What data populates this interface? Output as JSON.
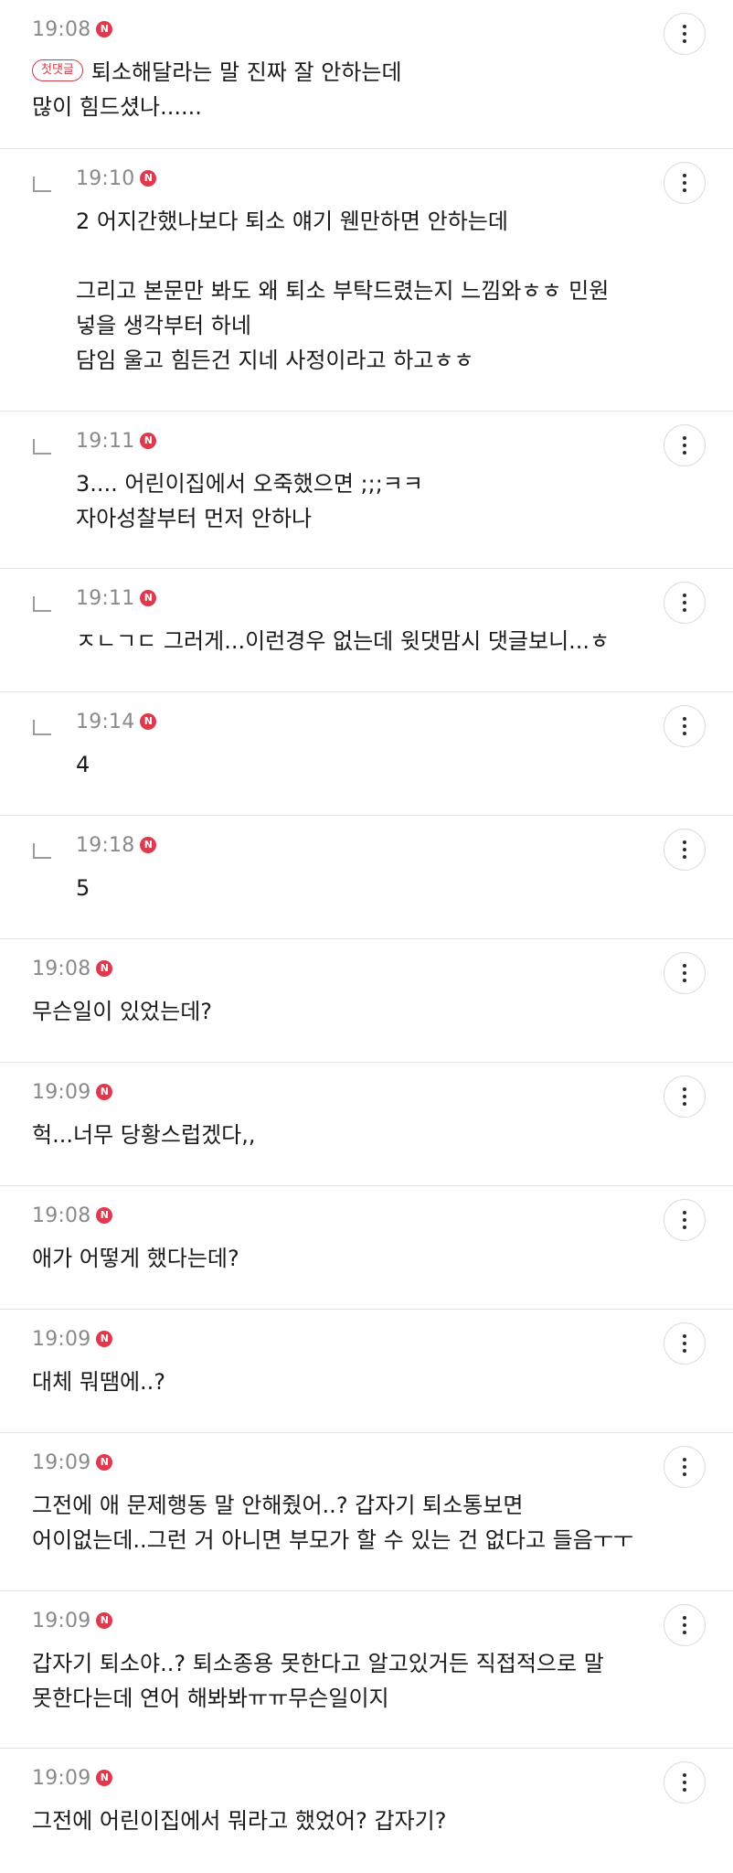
{
  "first_comment_label": "첫댓글",
  "comments": [
    {
      "time": "19:08",
      "reply": false,
      "first": true,
      "lines": [
        "퇴소해달라는 말 진짜 잘 안하는데",
        "많이 힘드셨나......"
      ]
    },
    {
      "time": "19:10",
      "reply": true,
      "lines": [
        "2 어지간했나보다 퇴소 얘기 웬만하면 안하는데",
        "",
        "그리고 본문만 봐도 왜 퇴소 부탁드렸는지 느낌와ㅎㅎ 민원",
        "넣을 생각부터 하네",
        "담임 울고 힘든건 지네 사정이라고 하고ㅎㅎ"
      ]
    },
    {
      "time": "19:11",
      "reply": true,
      "lines": [
        "3.... 어린이집에서 오죽했으면 ;;;ㅋㅋ",
        "자아성찰부터 먼저 안하나"
      ]
    },
    {
      "time": "19:11",
      "reply": true,
      "lines": [
        "ㅈㄴㄱㄷ 그러게...이런경우 없는데 윗댓맘시 댓글보니...ㅎ"
      ]
    },
    {
      "time": "19:14",
      "reply": true,
      "lines": [
        "4"
      ]
    },
    {
      "time": "19:18",
      "reply": true,
      "lines": [
        "5"
      ]
    },
    {
      "time": "19:08",
      "reply": false,
      "lines": [
        "무슨일이 있었는데?"
      ]
    },
    {
      "time": "19:09",
      "reply": false,
      "lines": [
        "헉...너무 당황스럽겠다,,"
      ]
    },
    {
      "time": "19:08",
      "reply": false,
      "lines": [
        "애가 어떻게 했다는데?"
      ]
    },
    {
      "time": "19:09",
      "reply": false,
      "lines": [
        "대체 뭐땜에..?"
      ]
    },
    {
      "time": "19:09",
      "reply": false,
      "lines": [
        "그전에 애 문제행동 말 안해줬어..? 갑자기 퇴소통보면",
        "어이없는데..그런 거 아니면 부모가 할 수 있는 건 없다고 들음ㅜㅜ"
      ]
    },
    {
      "time": "19:09",
      "reply": false,
      "lines": [
        "갑자기 퇴소야..? 퇴소종용 못한다고 알고있거든 직접적으로 말",
        "못한다는데 연어 해봐봐ㅠㅠ무슨일이지"
      ]
    },
    {
      "time": "19:09",
      "reply": false,
      "lines": [
        "그전에 어린이집에서 뭐라고 했었어? 갑자기?"
      ]
    }
  ]
}
